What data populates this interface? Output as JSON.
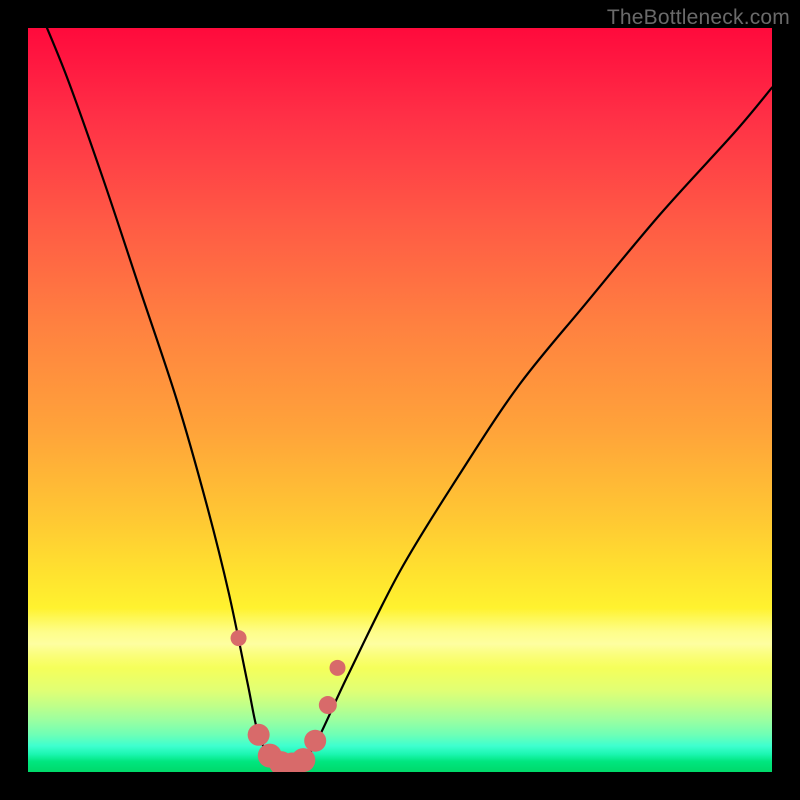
{
  "watermark": {
    "text": "TheBottleneck.com"
  },
  "chart_data": {
    "type": "line",
    "title": "",
    "xlabel": "",
    "ylabel": "",
    "xlim": [
      0,
      100
    ],
    "ylim": [
      0,
      100
    ],
    "grid": false,
    "legend": false,
    "series": [
      {
        "name": "bottleneck-curve",
        "x": [
          0,
          5,
          10,
          15,
          20,
          24,
          27,
          29.5,
          31,
          33,
          35,
          37,
          39,
          43,
          50,
          58,
          66,
          75,
          85,
          95,
          100
        ],
        "values": [
          106,
          94,
          80,
          65,
          50,
          36,
          24,
          12,
          5,
          1.5,
          0.8,
          1.6,
          4.5,
          13,
          27,
          40,
          52,
          63,
          75,
          86,
          92
        ]
      }
    ],
    "markers": {
      "name": "highlighted-points",
      "color": "#d86a6a",
      "x": [
        28.3,
        31.0,
        32.5,
        34.0,
        35.5,
        37.0,
        38.6,
        40.3,
        41.6
      ],
      "values": [
        18.0,
        5.0,
        2.2,
        1.2,
        1.0,
        1.6,
        4.2,
        9.0,
        14.0
      ],
      "radius": [
        8,
        11,
        12,
        12,
        12,
        12,
        11,
        9,
        8
      ]
    },
    "background_gradient": {
      "stops": [
        {
          "pos": 0.0,
          "color": "#ff0a3c"
        },
        {
          "pos": 0.4,
          "color": "#ff8140"
        },
        {
          "pos": 0.73,
          "color": "#ffe12f"
        },
        {
          "pos": 0.86,
          "color": "#f5ff5a"
        },
        {
          "pos": 1.0,
          "color": "#00d96a"
        }
      ]
    }
  }
}
